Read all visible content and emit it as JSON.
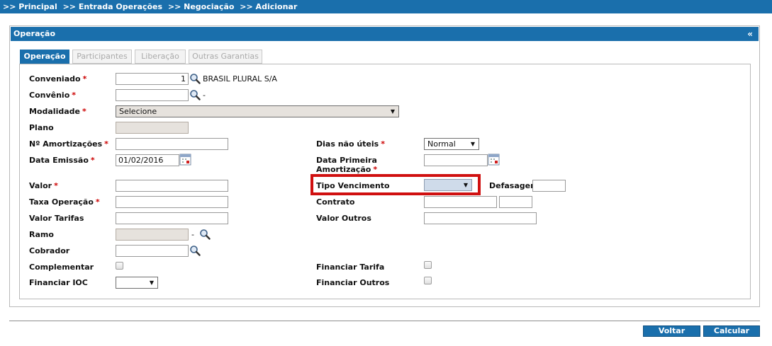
{
  "breadcrumb": [
    ">> Principal",
    ">> Entrada Operações",
    ">> Negociação",
    ">> Adicionar"
  ],
  "panel": {
    "title": "Operação",
    "collapse": "«"
  },
  "tabs": [
    "Operação",
    "Participantes",
    "Liberação",
    "Outras Garantias"
  ],
  "required_mark": "*",
  "fields": {
    "conveniado": {
      "label": "Conveniado",
      "value": "1",
      "description": "BRASIL PLURAL S/A"
    },
    "convenio": {
      "label": "Convênio",
      "value": "",
      "description": "-"
    },
    "modalidade": {
      "label": "Modalidade",
      "value": "Selecione"
    },
    "plano": {
      "label": "Plano",
      "value": ""
    },
    "amortizacoes": {
      "label": "Nº Amortizações",
      "value": ""
    },
    "dias_nao_uteis": {
      "label": "Dias não úteis",
      "value": "Normal"
    },
    "data_emissao": {
      "label": "Data Emissão",
      "value": "01/02/2016"
    },
    "data_primeira_amortizacao": {
      "label_line1": "Data Primeira",
      "label_line2": "Amortização",
      "value": ""
    },
    "valor": {
      "label": "Valor",
      "value": ""
    },
    "tipo_vencimento": {
      "label": "Tipo Vencimento",
      "value": ""
    },
    "defasagem": {
      "label": "Defasagem",
      "value": ""
    },
    "taxa_operacao": {
      "label": "Taxa Operação",
      "value": ""
    },
    "contrato": {
      "label": "Contrato",
      "value": "",
      "value2": ""
    },
    "valor_tarifas": {
      "label": "Valor Tarifas",
      "value": ""
    },
    "valor_outros": {
      "label": "Valor Outros",
      "value": ""
    },
    "ramo": {
      "label": "Ramo",
      "value": "",
      "description": "-"
    },
    "cobrador": {
      "label": "Cobrador",
      "value": ""
    },
    "complementar": {
      "label": "Complementar",
      "checked": false
    },
    "financiar_tarifa": {
      "label": "Financiar Tarifa",
      "checked": false
    },
    "financiar_ioc": {
      "label": "Financiar IOC",
      "value": ""
    },
    "financiar_outros": {
      "label": "Financiar Outros",
      "checked": false
    }
  },
  "buttons": {
    "voltar": "Voltar",
    "calcular": "Calcular"
  },
  "colors": {
    "header_blue": "#1a6fac",
    "required_red": "#cc0000",
    "highlight_red": "#d01010"
  }
}
